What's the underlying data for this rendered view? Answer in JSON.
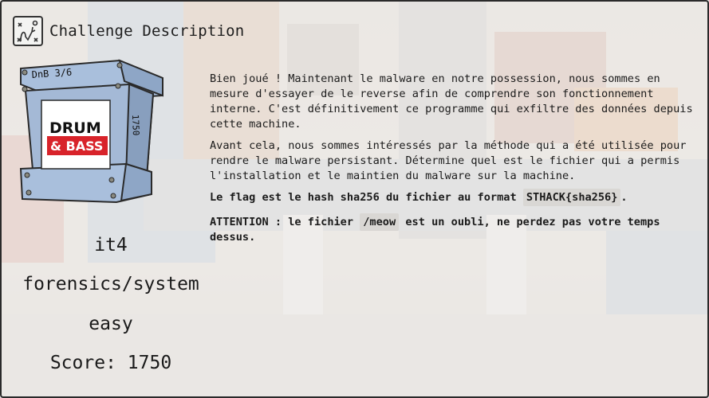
{
  "header": {
    "title": "Challenge Description",
    "icon": "forensics-category-icon"
  },
  "box": {
    "tag": "DnB 3/6",
    "side_number": "1750",
    "logo_line1": "DRUM",
    "logo_line2": "& BASS"
  },
  "challenge": {
    "name": "it4",
    "category": "forensics/system",
    "difficulty": "easy",
    "score_label": "Score:",
    "score": "1750"
  },
  "description": {
    "p1": "Bien joué ! Maintenant le malware en notre possession, nous sommes en mesure d'essayer de le reverse afin de comprendre son fonctionnement interne. C'est définitivement ce programme qui exfiltre des données depuis cette machine.",
    "p2": "Avant cela, nous sommes intéressés par la méthode qui a été utilisée pour rendre le malware persistant. Détermine quel est le fichier qui a permis l'installation et le maintien du malware sur la machine.",
    "p3_before": "Le flag est le hash sha256 du fichier au format ",
    "p3_code": "STHACK{sha256}",
    "p3_after": ".",
    "p4_before": "ATTENTION : le fichier ",
    "p4_code": "/meow",
    "p4_after": " est un oubli, ne perdez pas votre temps dessus."
  },
  "colors": {
    "box_blue": "#a9bfdc",
    "logo_red": "#d8232a",
    "code_bg": "#d9d7d4"
  }
}
